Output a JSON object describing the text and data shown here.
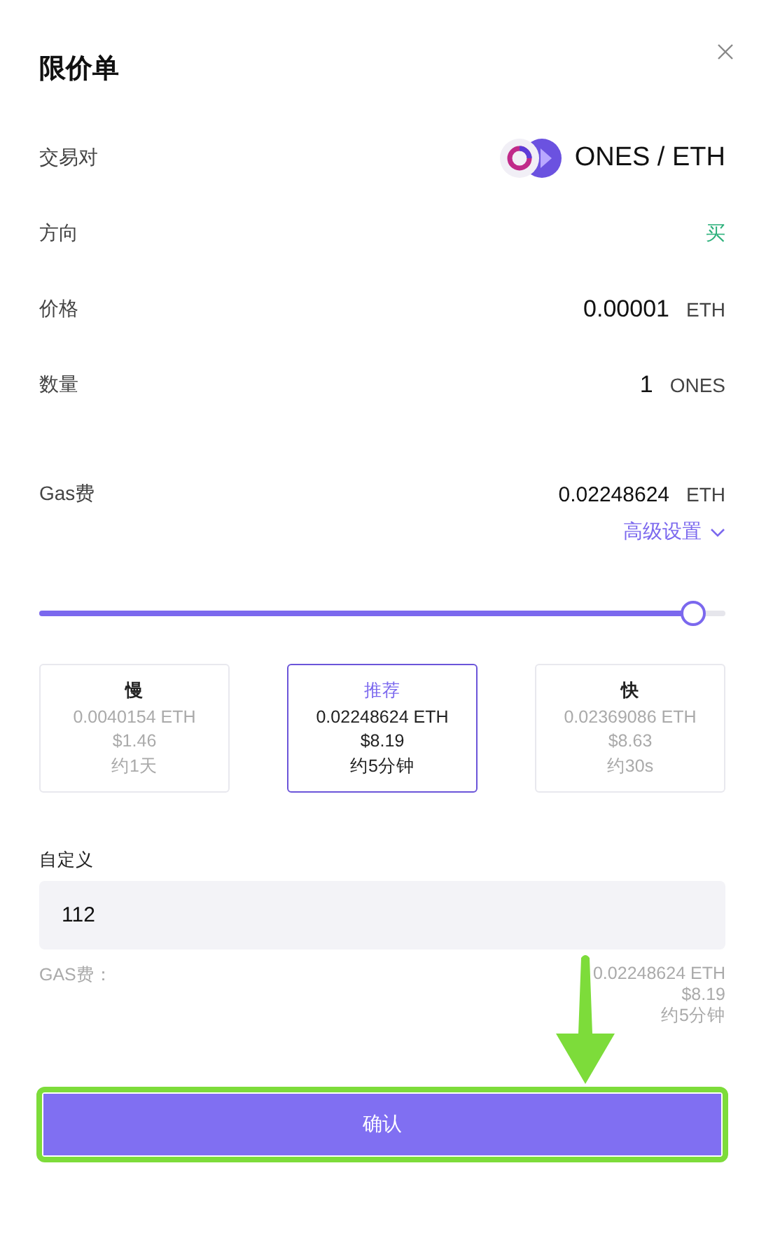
{
  "dialog": {
    "title": "限价单"
  },
  "fields": [
    {
      "label": "交易对",
      "kind": "pair",
      "value": "ONES / ETH"
    },
    {
      "label": "方向",
      "kind": "side",
      "value": "买"
    },
    {
      "label": "价格",
      "kind": "amount",
      "value": "0.00001",
      "unit": "ETH"
    },
    {
      "label": "数量",
      "kind": "amount",
      "value": "1",
      "unit": "ONES"
    }
  ],
  "gas": {
    "label": "Gas费",
    "value": "0.02248624",
    "unit": "ETH",
    "advanced": "高级设置"
  },
  "slider": {
    "level": 0.95
  },
  "speed_options": [
    {
      "name": "慢",
      "fee": "0.0040154 ETH",
      "usd": "$1.46",
      "time": "约1天",
      "selected": false
    },
    {
      "name": "推荐",
      "fee": "0.02248624 ETH",
      "usd": "$8.19",
      "time": "约5分钟",
      "selected": true
    },
    {
      "name": "快",
      "fee": "0.02369086 ETH",
      "usd": "$8.63",
      "time": "约30s",
      "selected": false
    }
  ],
  "custom": {
    "label": "自定义",
    "value": "112"
  },
  "summary": {
    "label": "GAS费：",
    "fee": "0.02248624 ETH",
    "usd": "$8.19",
    "time": "约5分钟"
  },
  "confirm_button": "确认"
}
